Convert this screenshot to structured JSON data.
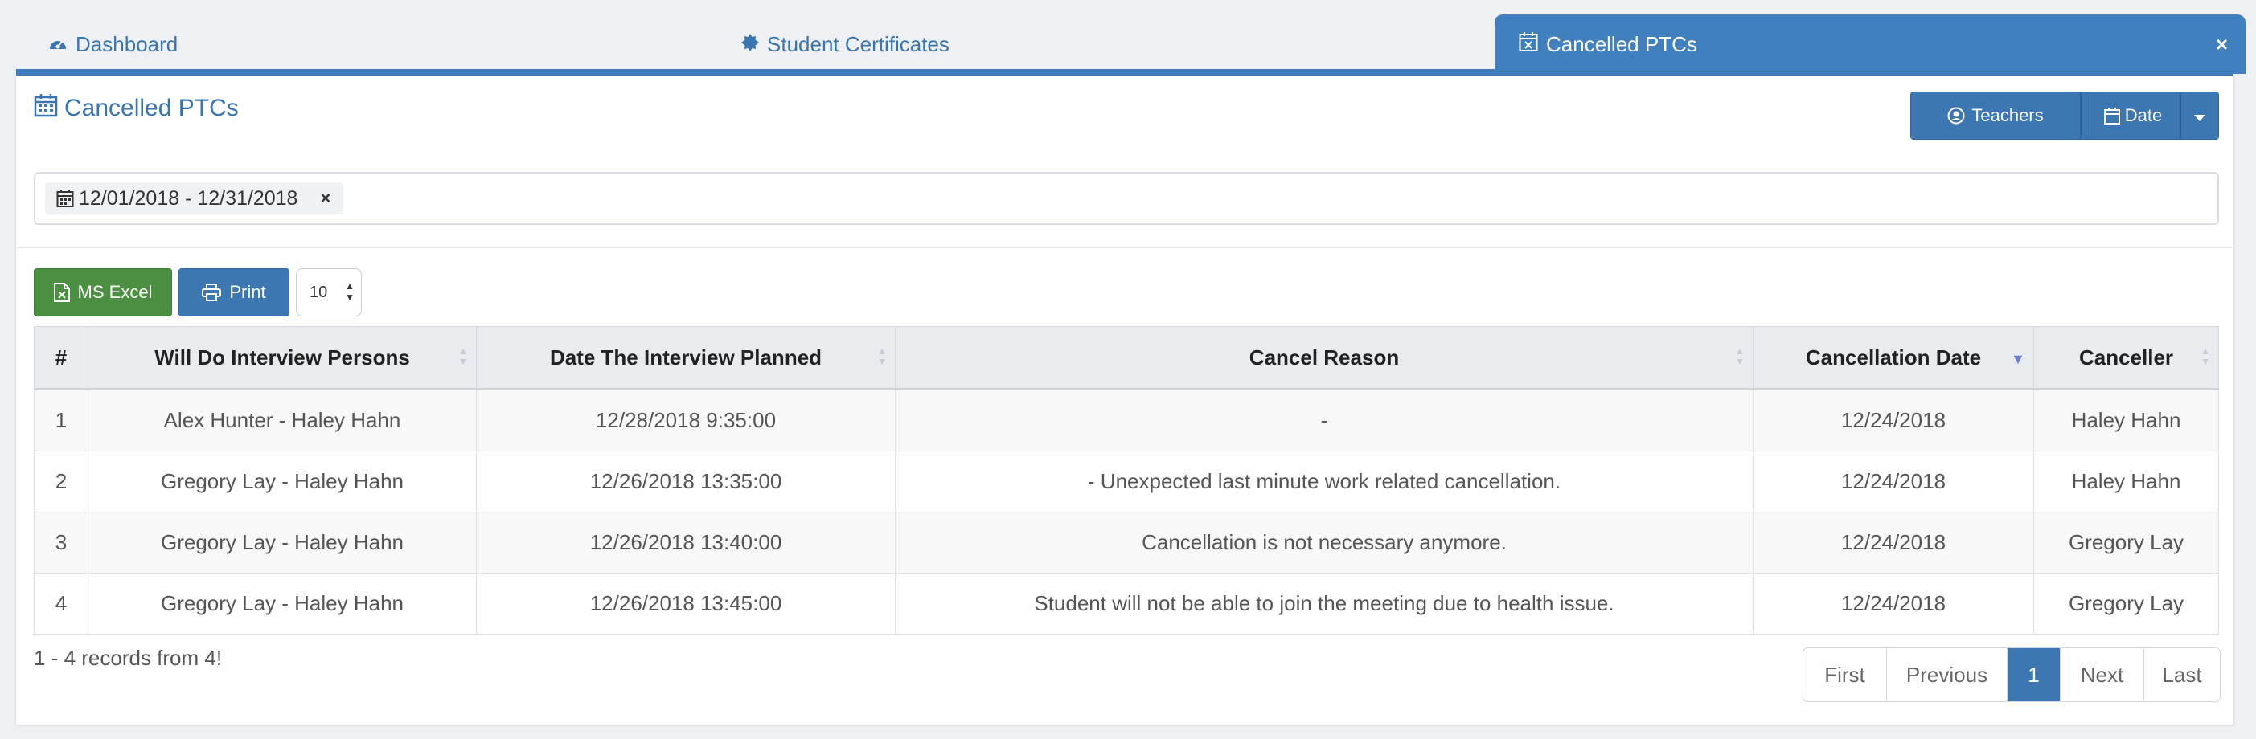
{
  "tabs": [
    {
      "label": "Dashboard",
      "icon": "dashboard-icon"
    },
    {
      "label": "Student Certificates",
      "icon": "certificate-icon"
    },
    {
      "label": "Cancelled PTCs",
      "icon": "calendar-x-icon",
      "active": true,
      "close": "×"
    }
  ],
  "panel": {
    "title": "Cancelled PTCs",
    "teachers_label": "Teachers",
    "date_label": "Date"
  },
  "filter": {
    "chip": "12/01/2018 - 12/31/2018",
    "remove": "×"
  },
  "toolbar": {
    "excel_label": "MS Excel",
    "print_label": "Print",
    "page_size": "10"
  },
  "table": {
    "headers": [
      "#",
      "Will Do Interview Persons",
      "Date The Interview Planned",
      "Cancel Reason",
      "Cancellation Date",
      "Canceller"
    ],
    "rows": [
      [
        "1",
        "Alex Hunter - Haley Hahn",
        "12/28/2018 9:35:00",
        "-",
        "12/24/2018",
        "Haley Hahn"
      ],
      [
        "2",
        "Gregory Lay - Haley Hahn",
        "12/26/2018 13:35:00",
        "- Unexpected last minute work related cancellation.",
        "12/24/2018",
        "Haley Hahn"
      ],
      [
        "3",
        "Gregory Lay - Haley Hahn",
        "12/26/2018 13:40:00",
        "Cancellation is not necessary anymore.",
        "12/24/2018",
        "Gregory Lay"
      ],
      [
        "4",
        "Gregory Lay - Haley Hahn",
        "12/26/2018 13:45:00",
        "Student will not be able to join the meeting due to health issue.",
        "12/24/2018",
        "Gregory Lay"
      ]
    ]
  },
  "footer": {
    "records": "1 - 4 records from 4!"
  },
  "pagination": {
    "first": "First",
    "previous": "Previous",
    "current": "1",
    "next": "Next",
    "last": "Last"
  },
  "colors": {
    "accent": "#3d77b2",
    "excel": "#4a9040"
  }
}
